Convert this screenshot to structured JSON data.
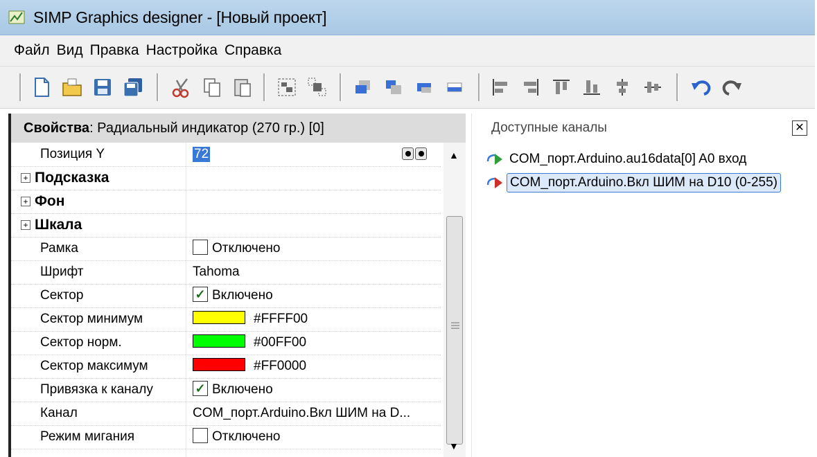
{
  "window": {
    "title": "SIMP Graphics designer - [Новый проект]"
  },
  "menu": [
    "Файл",
    "Вид",
    "Правка",
    "Настройка",
    "Справка"
  ],
  "toolbar": {
    "buttons": [
      "new-file-icon",
      "open-folder-icon",
      "save-icon",
      "save-all-icon",
      "cut-icon",
      "copy-icon",
      "paste-icon",
      "group-icon",
      "ungroup-icon",
      "bring-to-front-icon",
      "send-to-back-icon",
      "bring-forward-icon",
      "send-backward-icon",
      "align-left-icon",
      "align-right-icon",
      "align-top-icon",
      "align-bottom-icon",
      "center-horizontal-icon",
      "center-vertical-icon",
      "undo-icon",
      "redo-icon"
    ]
  },
  "properties": {
    "header_bold": "Свойства",
    "header_rest": ": Радиальный индикатор (270 гр.) [0]",
    "rows": {
      "pos_y": {
        "name": "Позиция Y",
        "value": "72"
      },
      "hint": {
        "name": "Подсказка"
      },
      "background": {
        "name": "Фон"
      },
      "scale": {
        "name": "Шкала"
      },
      "frame": {
        "name": "Рамка",
        "value": "Отключено"
      },
      "font": {
        "name": "Шрифт",
        "value": "Tahoma"
      },
      "sector": {
        "name": "Сектор",
        "value": "Включено"
      },
      "sector_min": {
        "name": "Сектор минимум",
        "value": "#FFFF00",
        "color": "#FFFF00"
      },
      "sector_norm": {
        "name": "Сектор норм.",
        "value": "#00FF00",
        "color": "#00FF00"
      },
      "sector_max": {
        "name": "Сектор максимум",
        "value": "#FF0000",
        "color": "#FF0000"
      },
      "bind": {
        "name": "Привязка к каналу",
        "value": "Включено"
      },
      "channel": {
        "name": "Канал",
        "value": "COM_порт.Arduino.Вкл ШИМ на D..."
      },
      "blink": {
        "name": "Режим мигания",
        "value": "Отключено"
      }
    }
  },
  "channels_panel": {
    "title": "Доступные каналы",
    "items": [
      {
        "label": "COM_порт.Arduino.au16data[0]  A0 вход",
        "icon": "input-channel-icon"
      },
      {
        "label": "COM_порт.Arduino.Вкл ШИМ на D10 (0-255)",
        "icon": "output-channel-icon",
        "selected": true
      }
    ]
  },
  "colors": {
    "titlebar": "#bcd6ec",
    "selection": "#3a78d6"
  }
}
